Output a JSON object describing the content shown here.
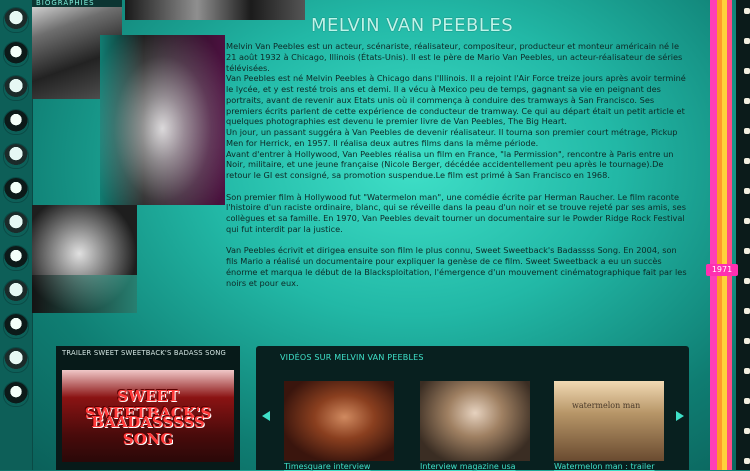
{
  "header": {
    "section_tag": "BIOGRAPHIES",
    "title": "MELVIN VAN PEEBLES"
  },
  "bio": {
    "paragraphs": [
      "Melvin Van Peebles est un acteur, scénariste, réalisateur, compositeur, producteur et monteur américain né le 21 août 1932 à Chicago, Illinois (États-Unis). Il est le père de Mario Van Peebles, un acteur-réalisateur de séries télévisées.",
      "Van Peebles est né Melvin Peebles à Chicago dans l'Illinois. Il a rejoint l'Air Force treize jours après avoir terminé le lycée, et y est resté trois ans et demi. Il a vécu à Mexico peu de temps, gagnant sa vie en peignant des portraits, avant de revenir aux Etats unis où il commença à conduire des tramways à San Francisco. Ses premiers écrits parlent de cette expérience de conducteur de tramway. Ce qui au départ était un petit article et quelques photographies est devenu le premier livre de Van Peebles, The Big Heart.",
      "Un jour, un passant suggéra à Van Peebles de devenir réalisateur. Il tourna son premier court métrage, Pickup Men for Herrick, en 1957. Il réalisa deux autres films dans la même période.",
      "Avant d'entrer à Hollywood, Van Peebles réalisa un film en France, \"la Permission\", rencontre à Paris entre un Noir, militaire, et une jeune française (Nicole Berger, décédée accidentellement peu après le tournage).De retour le GI est consigné, sa promotion suspendue.Le film est primé à San Francisco en 1968.",
      "Son premier film à Hollywood fut \"Watermelon man\", une comédie écrite par Herman Raucher. Le film raconte l'histoire d'un raciste ordinaire, blanc, qui se réveille dans la peau d'un noir et se trouve rejeté par ses amis, ses collègues et sa famille. En 1970, Van Peebles devait tourner un documentaire sur le Powder Ridge Rock Festival qui fut interdit par la justice.",
      "Van Peebles écrivit et dirigea ensuite son film le plus connu, Sweet Sweetback's Badassss Song. En 2004, son fils Mario a réalisé un documentaire pour expliquer la genèse de ce film. Sweet Sweetback a eu un succès énorme et marqua le début de la Blacksploitation, l'émergence d'un mouvement cinématographique fait par les noirs et pour eux."
    ]
  },
  "timeline": {
    "current_year": "1971",
    "accent_colors": [
      "#ff3fb8",
      "#ff9a2a",
      "#ffd23a",
      "#ff4d86"
    ]
  },
  "trailer": {
    "label": "TRAILER SWEET SWEETBACK'S BADASS SONG",
    "video_title_line1": "SWEET SWEETBACK'S",
    "video_title_line2": "BAADASSSSS SONG"
  },
  "videos": {
    "label": "VIDÉOS SUR MELVIN VAN PEEBLES",
    "items": [
      {
        "caption": "Timesquare interview"
      },
      {
        "caption": "Interview magazine usa"
      },
      {
        "caption": "Watermelon man : trailer",
        "thumb_text": "watermelon man"
      }
    ]
  },
  "colors": {
    "accent": "#3fe0c8",
    "panel": "#08201f",
    "text": "#0d2a27"
  }
}
